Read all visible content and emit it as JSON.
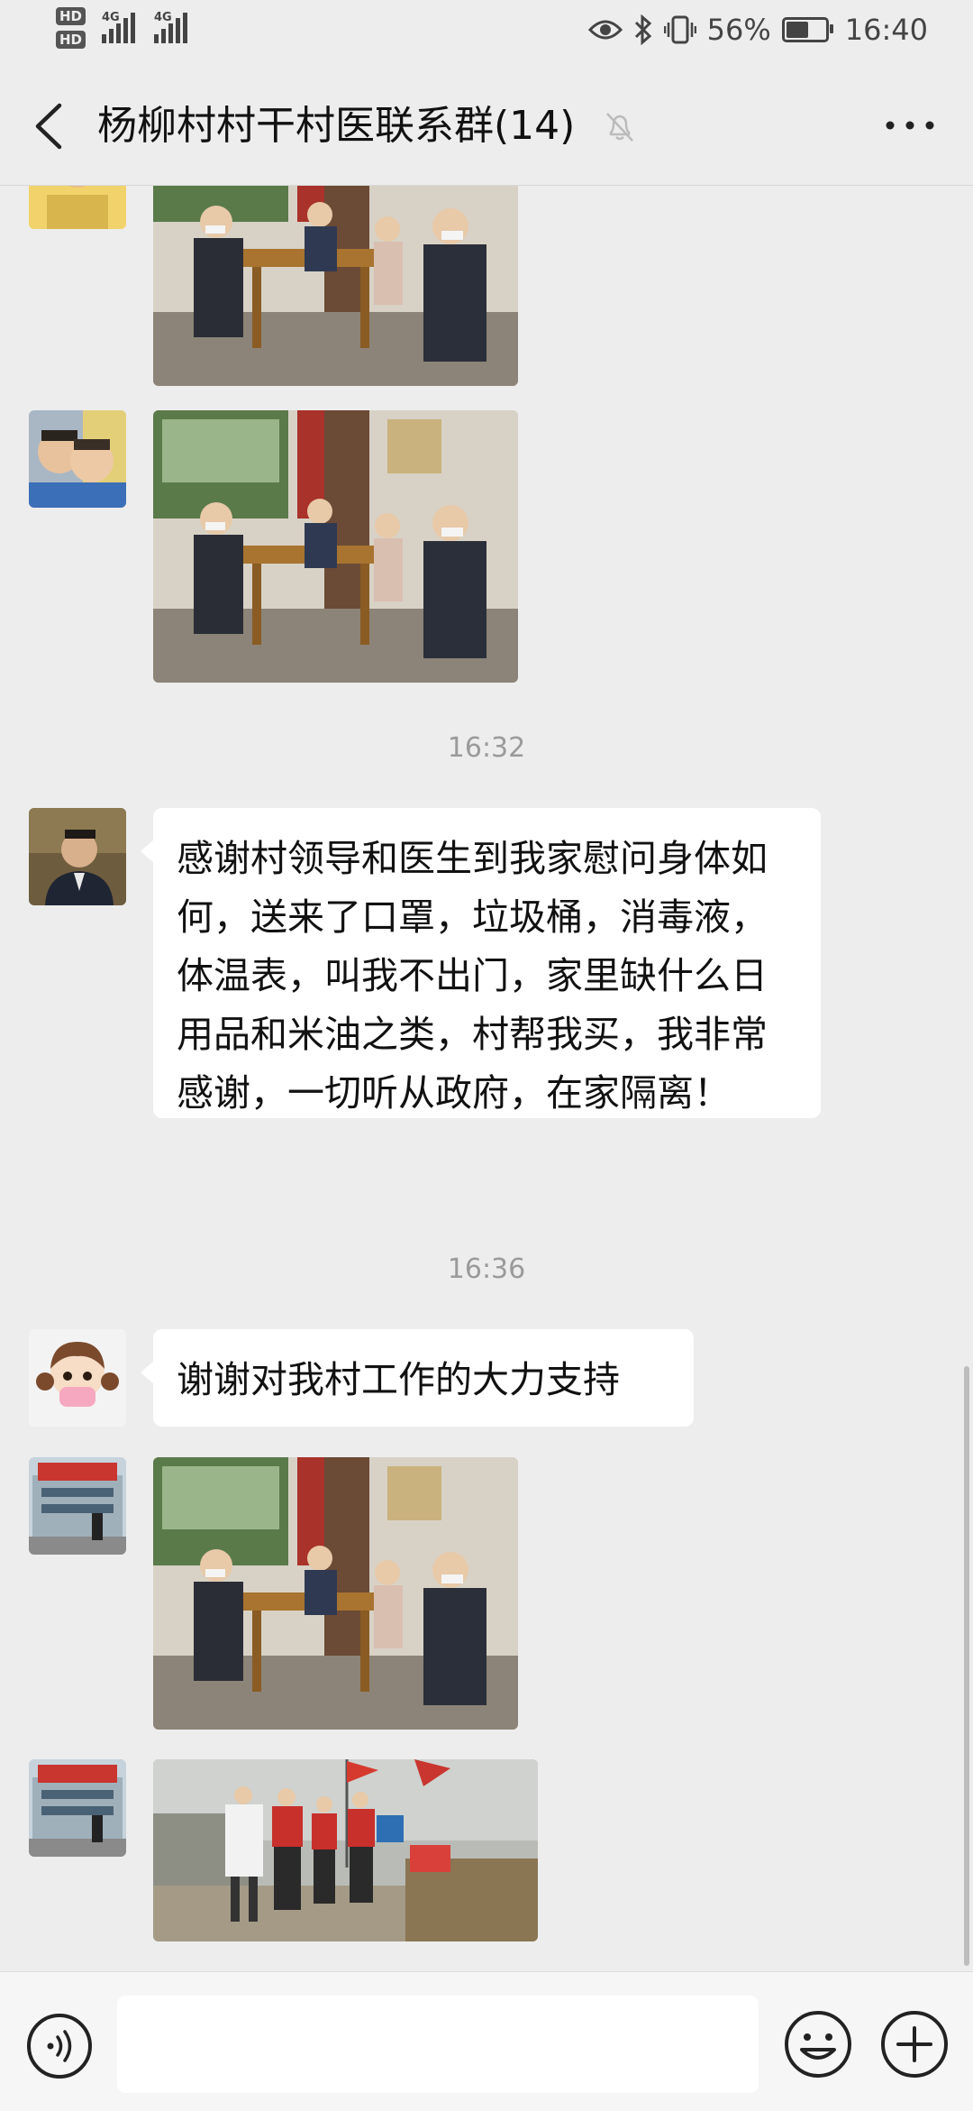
{
  "status_bar": {
    "hd1": "HD",
    "hd2": "HD",
    "net1": "4G",
    "net2": "4G",
    "battery_percent": "56%",
    "battery_level": 0.56,
    "time": "16:40"
  },
  "header": {
    "title": "杨柳村村干村医联系群(14)",
    "icons": [
      "back-arrow-icon",
      "mute-bell-icon",
      "more-icon"
    ]
  },
  "messages": [
    {
      "type": "image",
      "sender_avatar": "yellow-avatar",
      "depicts": "people-in-room-photo"
    },
    {
      "type": "image",
      "sender_avatar": "children-avatar",
      "depicts": "people-in-room-photo"
    },
    {
      "type": "timestamp",
      "text": "16:32"
    },
    {
      "type": "text",
      "sender_avatar": "man-avatar",
      "text": "感谢村领导和医生到我家慰问身体如何，送来了口罩，垃圾桶，消毒液，体温表，叫我不出门，家里缺什么日用品和米油之类，村帮我买，我非常感谢，一切听从政府，在家隔离！"
    },
    {
      "type": "timestamp",
      "text": "16:36"
    },
    {
      "type": "text",
      "sender_avatar": "cartoon-girl-avatar",
      "text": "谢谢对我村工作的大力支持"
    },
    {
      "type": "image",
      "sender_avatar": "building-avatar",
      "depicts": "people-in-room-photo"
    },
    {
      "type": "image",
      "sender_avatar": "building-avatar",
      "depicts": "checkpoint-outdoor-photo"
    }
  ],
  "input_bar": {
    "placeholder": "",
    "icons": [
      "voice-icon",
      "emoji-icon",
      "plus-icon"
    ]
  },
  "colors": {
    "background": "#ededed",
    "bubble": "#ffffff",
    "timestamp": "#9a9a9a",
    "text": "#111111"
  }
}
